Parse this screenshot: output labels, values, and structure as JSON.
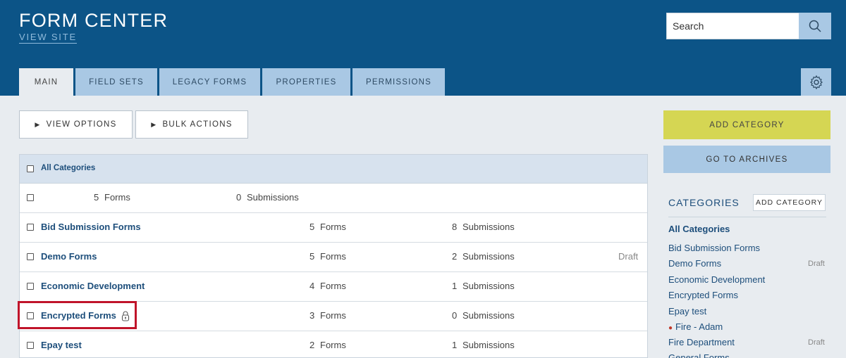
{
  "header": {
    "title": "FORM CENTER",
    "view_site": "VIEW SITE",
    "search_placeholder": "Search"
  },
  "tabs": [
    {
      "label": "MAIN",
      "active": true
    },
    {
      "label": "FIELD SETS"
    },
    {
      "label": "LEGACY FORMS"
    },
    {
      "label": "PROPERTIES"
    },
    {
      "label": "PERMISSIONS"
    }
  ],
  "toolbar": {
    "view_options": "VIEW OPTIONS",
    "bulk_actions": "BULK ACTIONS"
  },
  "table": {
    "header_label": "All Categories",
    "summary": {
      "forms": "5",
      "forms_label": "Forms",
      "submissions": "0",
      "submissions_label": "Submissions"
    },
    "rows": [
      {
        "name": "Bid Submission Forms",
        "forms": "5",
        "forms_label": "Forms",
        "submissions": "8",
        "submissions_label": "Submissions",
        "status": ""
      },
      {
        "name": "Demo Forms",
        "forms": "5",
        "forms_label": "Forms",
        "submissions": "2",
        "submissions_label": "Submissions",
        "status": "Draft"
      },
      {
        "name": "Economic Development",
        "forms": "4",
        "forms_label": "Forms",
        "submissions": "1",
        "submissions_label": "Submissions",
        "status": ""
      },
      {
        "name": "Encrypted Forms",
        "forms": "3",
        "forms_label": "Forms",
        "submissions": "0",
        "submissions_label": "Submissions",
        "status": "",
        "locked": true
      },
      {
        "name": "Epay test",
        "forms": "2",
        "forms_label": "Forms",
        "submissions": "1",
        "submissions_label": "Submissions",
        "status": ""
      }
    ]
  },
  "sidebar": {
    "add_category": "ADD CATEGORY",
    "go_to_archives": "GO TO ARCHIVES",
    "categories_heading": "CATEGORIES",
    "categories_add": "ADD CATEGORY",
    "items": [
      {
        "label": "All Categories",
        "bold": true
      },
      {
        "label": "Bid Submission Forms"
      },
      {
        "label": "Demo Forms",
        "status": "Draft"
      },
      {
        "label": "Economic Development"
      },
      {
        "label": "Encrypted Forms"
      },
      {
        "label": "Epay test"
      },
      {
        "label": "Fire - Adam",
        "bullet": true
      },
      {
        "label": "Fire Department",
        "status": "Draft"
      },
      {
        "label": "General Forms"
      }
    ]
  },
  "colors": {
    "header_bg": "#0c5487",
    "tab_bg": "#a9c8e4",
    "add_category_bg": "#d5d653",
    "highlight": "#c0142a",
    "link": "#1d4e7b"
  }
}
